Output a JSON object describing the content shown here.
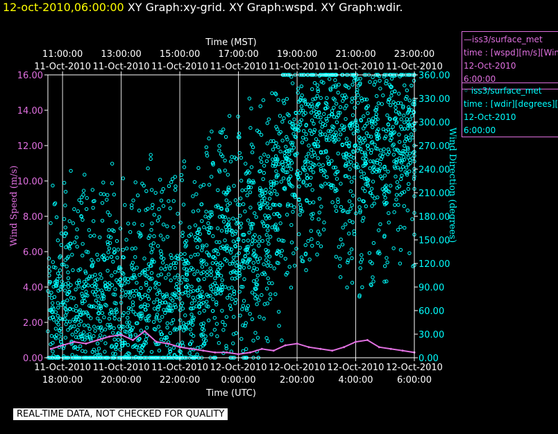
{
  "title": {
    "timestamp": "12-oct-2010,06:00:00",
    "graphs": "XY Graph:xy-grid.  XY Graph:wspd.  XY Graph:wdir."
  },
  "legend": [
    {
      "series": "iss3/surface_met",
      "line1": "time : [wspd][m/s][Wind",
      "line2": "12-Oct-2010",
      "line3": "6:00:00",
      "color": "#e070e0",
      "marker": "line"
    },
    {
      "series": "iss3/surface_met",
      "line1": "time : [wdir][degrees][V",
      "line2": "12-Oct-2010",
      "line3": "6:00:00",
      "color": "#00ffff",
      "marker": "circle"
    }
  ],
  "disclaimer": "REAL-TIME DATA, NOT CHECKED FOR QUALITY",
  "chart_data": {
    "type": "scatter",
    "x_top_label": "Time (MST)",
    "x_bottom_label": "Time (UTC)",
    "y_left_label": "Wind Speed (m/s)",
    "y_right_label": "Wind Direction (degrees)",
    "x_top_ticks": [
      {
        "time": "11:00:00",
        "date": "11-Oct-2010"
      },
      {
        "time": "13:00:00",
        "date": "11-Oct-2010"
      },
      {
        "time": "15:00:00",
        "date": "11-Oct-2010"
      },
      {
        "time": "17:00:00",
        "date": "11-Oct-2010"
      },
      {
        "time": "19:00:00",
        "date": "11-Oct-2010"
      },
      {
        "time": "21:00:00",
        "date": "11-Oct-2010"
      },
      {
        "time": "23:00:00",
        "date": "11-Oct-2010"
      }
    ],
    "x_bottom_ticks": [
      {
        "date": "11-Oct-2010",
        "time": "18:00:00"
      },
      {
        "date": "11-Oct-2010",
        "time": "20:00:00"
      },
      {
        "date": "11-Oct-2010",
        "time": "22:00:00"
      },
      {
        "date": "12-Oct-2010",
        "time": "0:00:00"
      },
      {
        "date": "12-Oct-2010",
        "time": "2:00:00"
      },
      {
        "date": "12-Oct-2010",
        "time": "4:00:00"
      },
      {
        "date": "12-Oct-2010",
        "time": "6:00:00"
      }
    ],
    "x_range_utc": [
      "2010-10-11 17:30",
      "2010-10-12 06:00"
    ],
    "y_left_ticks": [
      "0.00",
      "2.00",
      "4.00",
      "6.00",
      "8.00",
      "10.00",
      "12.00",
      "14.00",
      "16.00"
    ],
    "y_left_range": [
      0,
      16
    ],
    "y_right_ticks": [
      "0.00",
      "30.00",
      "60.00",
      "90.00",
      "120.00",
      "150.00",
      "180.00",
      "210.00",
      "240.00",
      "270.00",
      "300.00",
      "330.00",
      "360.00"
    ],
    "y_right_range": [
      0,
      360
    ],
    "grid": true,
    "series": [
      {
        "name": "iss3/surface_met time : [wspd][m/s]",
        "axis": "left",
        "color": "#e070e0",
        "x_hours_utc": [
          17.6,
          18.0,
          18.4,
          18.8,
          19.2,
          19.6,
          20.0,
          20.4,
          20.8,
          21.2,
          21.6,
          22.0,
          22.4,
          22.8,
          23.2,
          23.6,
          24.0,
          24.4,
          24.8,
          25.2,
          25.6,
          26.0,
          26.4,
          26.8,
          27.2,
          27.6,
          28.0,
          28.4,
          28.8,
          29.2,
          29.6,
          30.0
        ],
        "values": [
          0.5,
          0.7,
          0.9,
          0.8,
          1.0,
          1.2,
          1.3,
          1.0,
          1.5,
          0.9,
          0.8,
          0.6,
          0.5,
          0.4,
          0.3,
          0.3,
          0.2,
          0.3,
          0.5,
          0.4,
          0.7,
          0.8,
          0.6,
          0.5,
          0.4,
          0.6,
          0.9,
          1.0,
          0.6,
          0.5,
          0.4,
          0.3
        ]
      },
      {
        "name": "iss3/surface_met time : [wdir][degrees]",
        "axis": "right",
        "color": "#00ffff",
        "x_hours_utc": [
          17.6,
          17.8,
          18.0,
          18.2,
          18.4,
          18.6,
          18.8,
          19.0,
          19.2,
          19.4,
          19.6,
          19.8,
          20.0,
          20.2,
          20.4,
          20.6,
          20.8,
          21.0,
          21.2,
          21.4,
          21.6,
          21.8,
          22.0,
          22.2,
          22.4,
          22.6,
          22.8,
          23.0,
          23.2,
          23.4,
          23.6,
          23.8,
          24.0,
          24.2,
          24.4,
          24.6,
          24.8,
          25.0,
          25.2,
          25.4,
          25.6,
          25.8,
          26.0,
          26.2,
          26.4,
          26.6,
          26.8,
          27.0,
          27.2,
          27.4,
          27.6,
          27.8,
          28.0,
          28.2,
          28.4,
          28.6,
          28.8,
          29.0,
          29.2,
          29.4,
          29.6,
          29.8,
          30.0
        ],
        "values": [
          60,
          45,
          70,
          90,
          40,
          55,
          80,
          65,
          50,
          75,
          95,
          60,
          70,
          45,
          85,
          55,
          65,
          100,
          50,
          70,
          60,
          80,
          75,
          90,
          55,
          110,
          70,
          130,
          95,
          140,
          160,
          120,
          150,
          100,
          170,
          130,
          200,
          150,
          220,
          180,
          250,
          240,
          260,
          280,
          270,
          290,
          300,
          280,
          310,
          260,
          290,
          240,
          300,
          230,
          270,
          250,
          280,
          240,
          290,
          300,
          260,
          280,
          270
        ]
      }
    ]
  }
}
